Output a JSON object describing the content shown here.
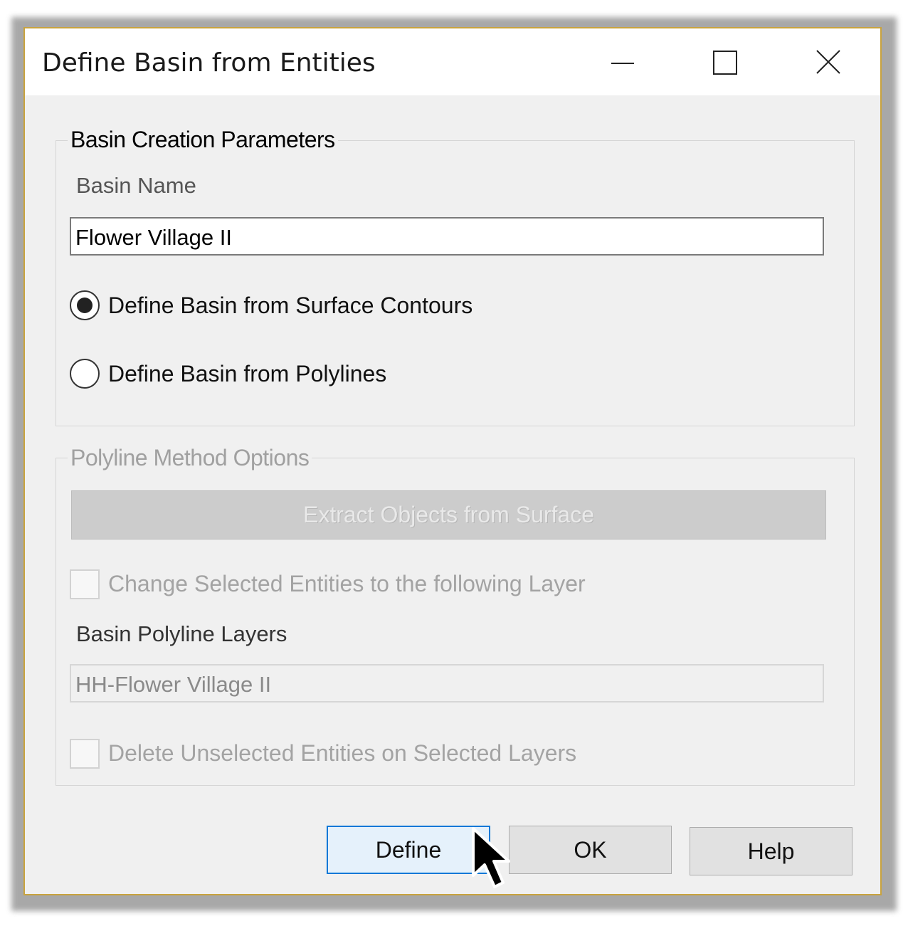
{
  "window": {
    "title": "Define Basin from Entities",
    "controls": [
      "minimize",
      "maximize",
      "close"
    ]
  },
  "basin_creation": {
    "legend": "Basin Creation Parameters",
    "basin_name_label": "Basin Name",
    "basin_name_value": "Flower Village II",
    "radio_options": [
      {
        "label": "Define Basin from Surface Contours",
        "selected": true
      },
      {
        "label": "Define Basin from Polylines",
        "selected": false
      }
    ]
  },
  "polyline_options": {
    "legend": "Polyline Method Options",
    "extract_button": "Extract Objects from Surface",
    "change_layer_checkbox": "Change Selected Entities to the following Layer",
    "layers_label": "Basin Polyline Layers",
    "layers_value": "HH-Flower Village II",
    "delete_checkbox": "Delete Unselected Entities on Selected  Layers",
    "enabled": false
  },
  "buttons": {
    "define": "Define",
    "ok": "OK",
    "help": "Help"
  },
  "icons": {
    "minimize": "minimize-icon",
    "maximize": "maximize-icon",
    "close": "close-icon",
    "cursor": "mouse-pointer-icon"
  },
  "colors": {
    "window_border": "#c9a33e",
    "focus_blue": "#0078d7",
    "dialog_bg": "#f0f0f0"
  }
}
